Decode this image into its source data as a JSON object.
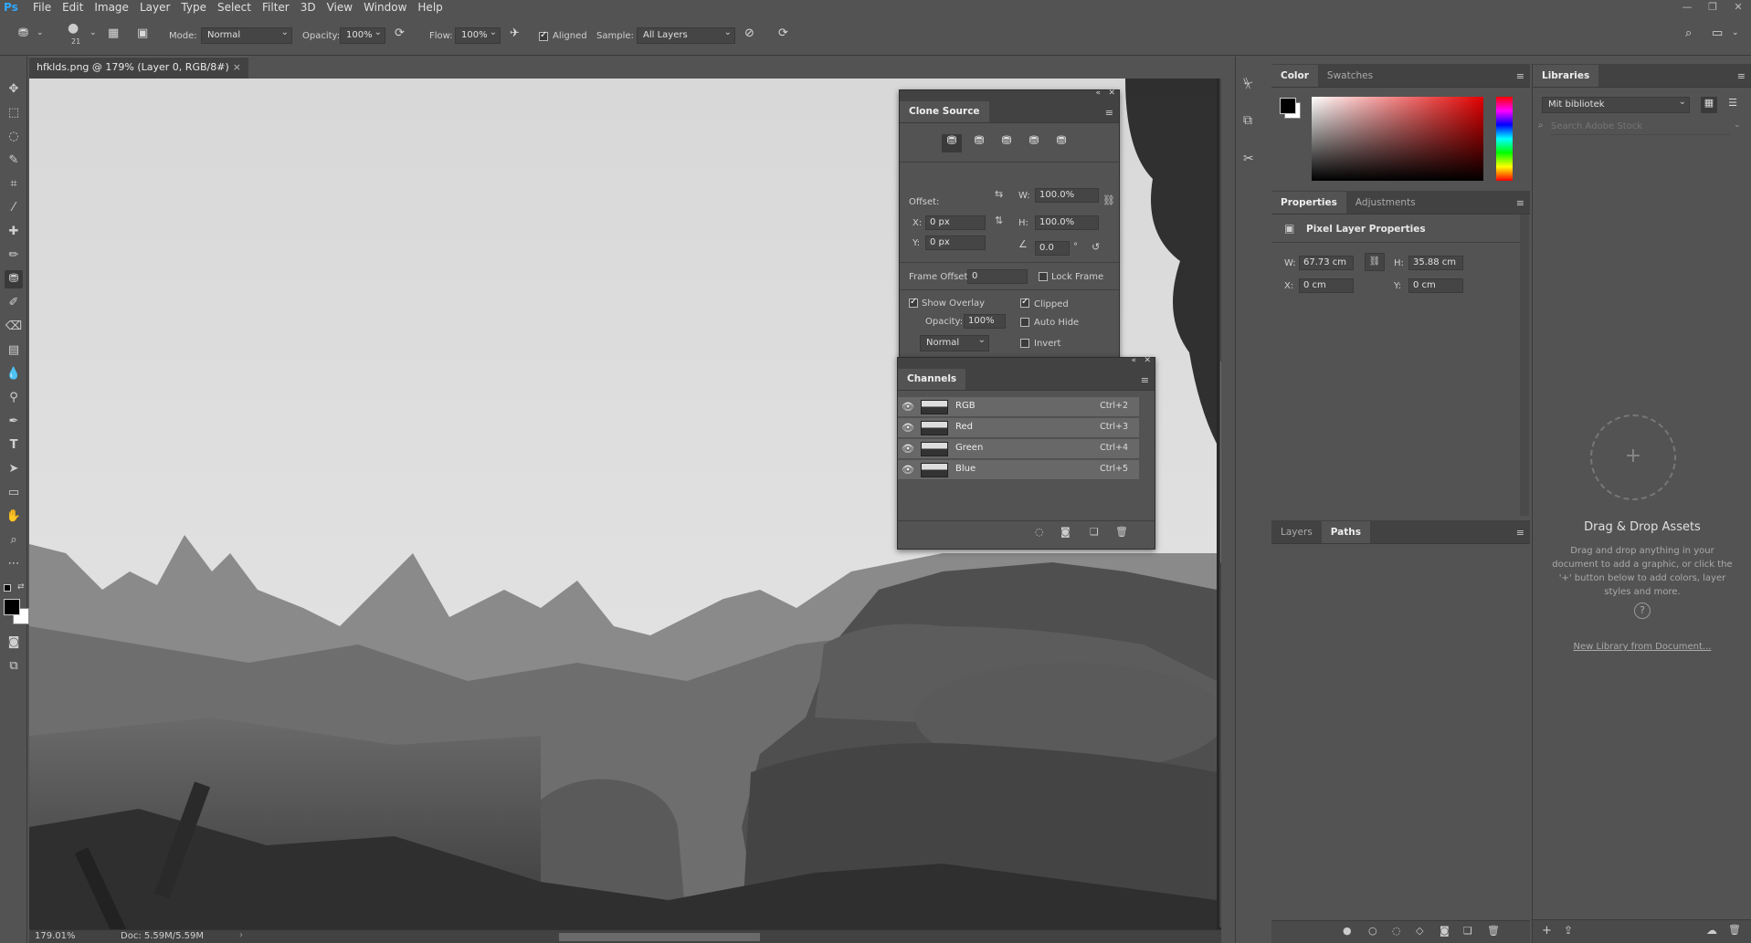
{
  "app": {
    "logo": "Ps",
    "menu": [
      "File",
      "Edit",
      "Image",
      "Layer",
      "Type",
      "Select",
      "Filter",
      "3D",
      "View",
      "Window",
      "Help"
    ],
    "win_controls": [
      "—",
      "❐",
      "✕"
    ]
  },
  "options": {
    "brush_size": "21",
    "mode_label": "Mode:",
    "mode_value": "Normal",
    "opacity_label": "Opacity:",
    "opacity_value": "100%",
    "flow_label": "Flow:",
    "flow_value": "100%",
    "aligned_label": "Aligned",
    "aligned_checked": true,
    "sample_label": "Sample:",
    "sample_value": "All Layers"
  },
  "document": {
    "tab_title": "hfklds.png @ 179% (Layer 0, RGB/8#)",
    "zoom": "179.01%",
    "doc_info": "Doc: 5.59M/5.59M"
  },
  "clone_source": {
    "title": "Clone Source",
    "offset_label": "Offset:",
    "x_label": "X:",
    "x_value": "0 px",
    "y_label": "Y:",
    "y_value": "0 px",
    "w_label": "W:",
    "w_value": "100.0%",
    "h_label": "H:",
    "h_value": "100.0%",
    "angle_value": "0.0",
    "angle_unit": "°",
    "frame_offset_label": "Frame Offset:",
    "frame_offset_value": "0",
    "lock_frame_label": "Lock Frame",
    "show_overlay_label": "Show Overlay",
    "clipped_label": "Clipped",
    "overlay_opacity_label": "Opacity:",
    "overlay_opacity_value": "100%",
    "auto_hide_label": "Auto Hide",
    "blend_value": "Normal",
    "invert_label": "Invert"
  },
  "channels": {
    "title": "Channels",
    "rows": [
      {
        "name": "RGB",
        "shortcut": "Ctrl+2"
      },
      {
        "name": "Red",
        "shortcut": "Ctrl+3"
      },
      {
        "name": "Green",
        "shortcut": "Ctrl+4"
      },
      {
        "name": "Blue",
        "shortcut": "Ctrl+5"
      }
    ]
  },
  "color_panel": {
    "tab_color": "Color",
    "tab_swatches": "Swatches"
  },
  "properties": {
    "tab_properties": "Properties",
    "tab_adjustments": "Adjustments",
    "heading": "Pixel Layer Properties",
    "w_label": "W:",
    "w_value": "67.73 cm",
    "h_label": "H:",
    "h_value": "35.88 cm",
    "x_label": "X:",
    "x_value": "0 cm",
    "y_label": "Y:",
    "y_value": "0 cm"
  },
  "layers_panel": {
    "tab_layers": "Layers",
    "tab_paths": "Paths"
  },
  "libraries": {
    "tab": "Libraries",
    "library_select": "Mit bibliotek",
    "search_placeholder": "Search Adobe Stock",
    "dd_title": "Drag & Drop Assets",
    "dd_text": "Drag and drop anything in your document to add a graphic, or click the '+' button below to add colors, layer styles and more.",
    "new_library_link": "New Library from Document..."
  }
}
